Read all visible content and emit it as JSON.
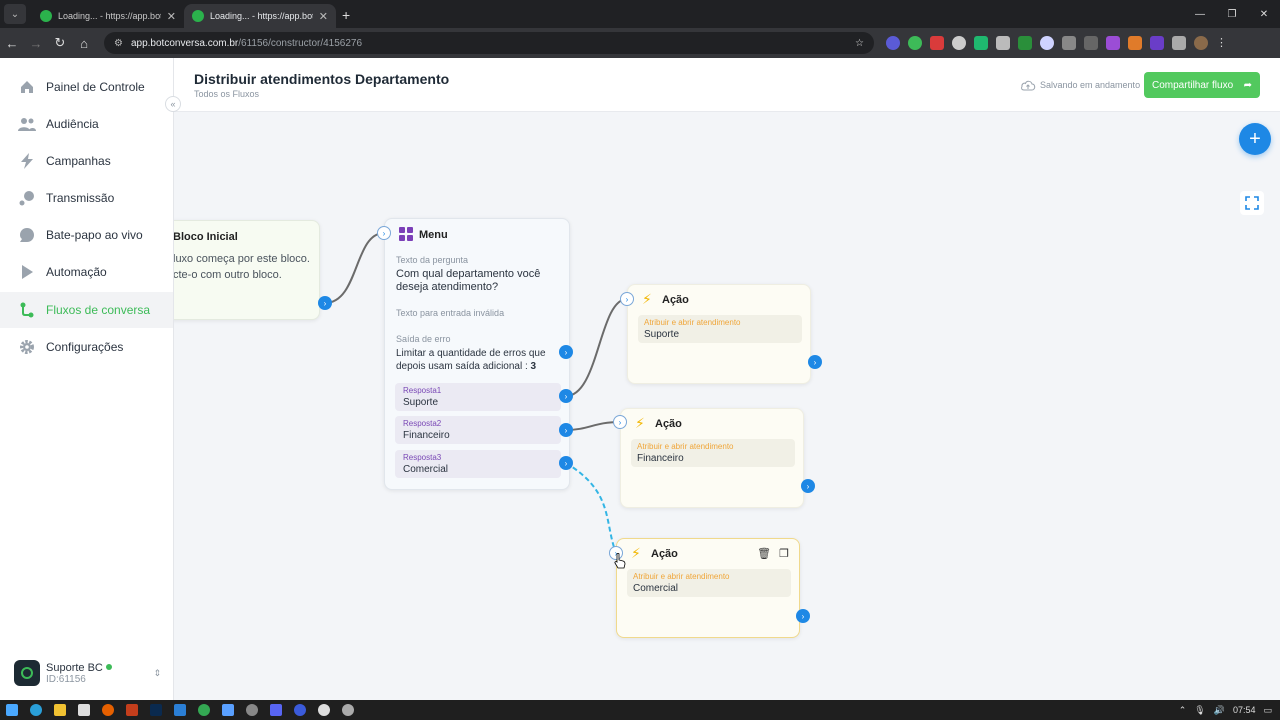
{
  "browser": {
    "tabs": [
      {
        "title": "Loading... - https://app.botcon",
        "active": false
      },
      {
        "title": "Loading... - https://app.botcon",
        "active": true
      }
    ],
    "url_host": "app.botconversa.com.br",
    "url_path": "/61156/constructor/4156276"
  },
  "sidebar": {
    "items": [
      {
        "label": "Painel de Controle",
        "icon": "home-icon"
      },
      {
        "label": "Audiência",
        "icon": "users-icon"
      },
      {
        "label": "Campanhas",
        "icon": "bolt-icon"
      },
      {
        "label": "Transmissão",
        "icon": "broadcast-icon"
      },
      {
        "label": "Bate-papo ao vivo",
        "icon": "chat-icon"
      },
      {
        "label": "Automação",
        "icon": "play-icon"
      },
      {
        "label": "Fluxos de conversa",
        "icon": "flow-icon",
        "active": true
      },
      {
        "label": "Configurações",
        "icon": "gear-icon"
      }
    ],
    "account": {
      "name": "Suporte BC",
      "id": "ID:61156"
    }
  },
  "header": {
    "title": "Distribuir atendimentos Departamento",
    "breadcrumb": "Todos os Fluxos",
    "saving_status": "Salvando em andamento",
    "share_label": "Compartilhar fluxo"
  },
  "canvas": {
    "start_block": {
      "title": "Bloco Inicial",
      "text": "luxo começa por este bloco. cte-o com outro bloco."
    },
    "menu_block": {
      "title": "Menu",
      "question_label": "Texto da pergunta",
      "question": "Com qual departamento você deseja atendimento?",
      "invalid_label": "Texto para entrada inválida",
      "error_label": "Saída de erro",
      "error_text": "Limitar a quantidade de erros que depois usam saída adicional : ",
      "error_count": "3",
      "responses": [
        {
          "label": "Resposta1",
          "value": "Suporte"
        },
        {
          "label": "Resposta2",
          "value": "Financeiro"
        },
        {
          "label": "Resposta3",
          "value": "Comercial"
        }
      ]
    },
    "action_blocks": [
      {
        "title": "Ação",
        "field_label": "Atribuir e abrir atendimento",
        "field_value": "Suporte"
      },
      {
        "title": "Ação",
        "field_label": "Atribuir e abrir atendimento",
        "field_value": "Financeiro"
      },
      {
        "title": "Ação",
        "field_label": "Atribuir e abrir atendimento",
        "field_value": "Comercial"
      }
    ]
  },
  "taskbar": {
    "time": "07:54"
  },
  "colors": {
    "accent_green": "#52c95e",
    "port_blue": "#1e88e5",
    "menu_purple": "#7b3fb8",
    "bolt_yellow": "#f2b705"
  }
}
